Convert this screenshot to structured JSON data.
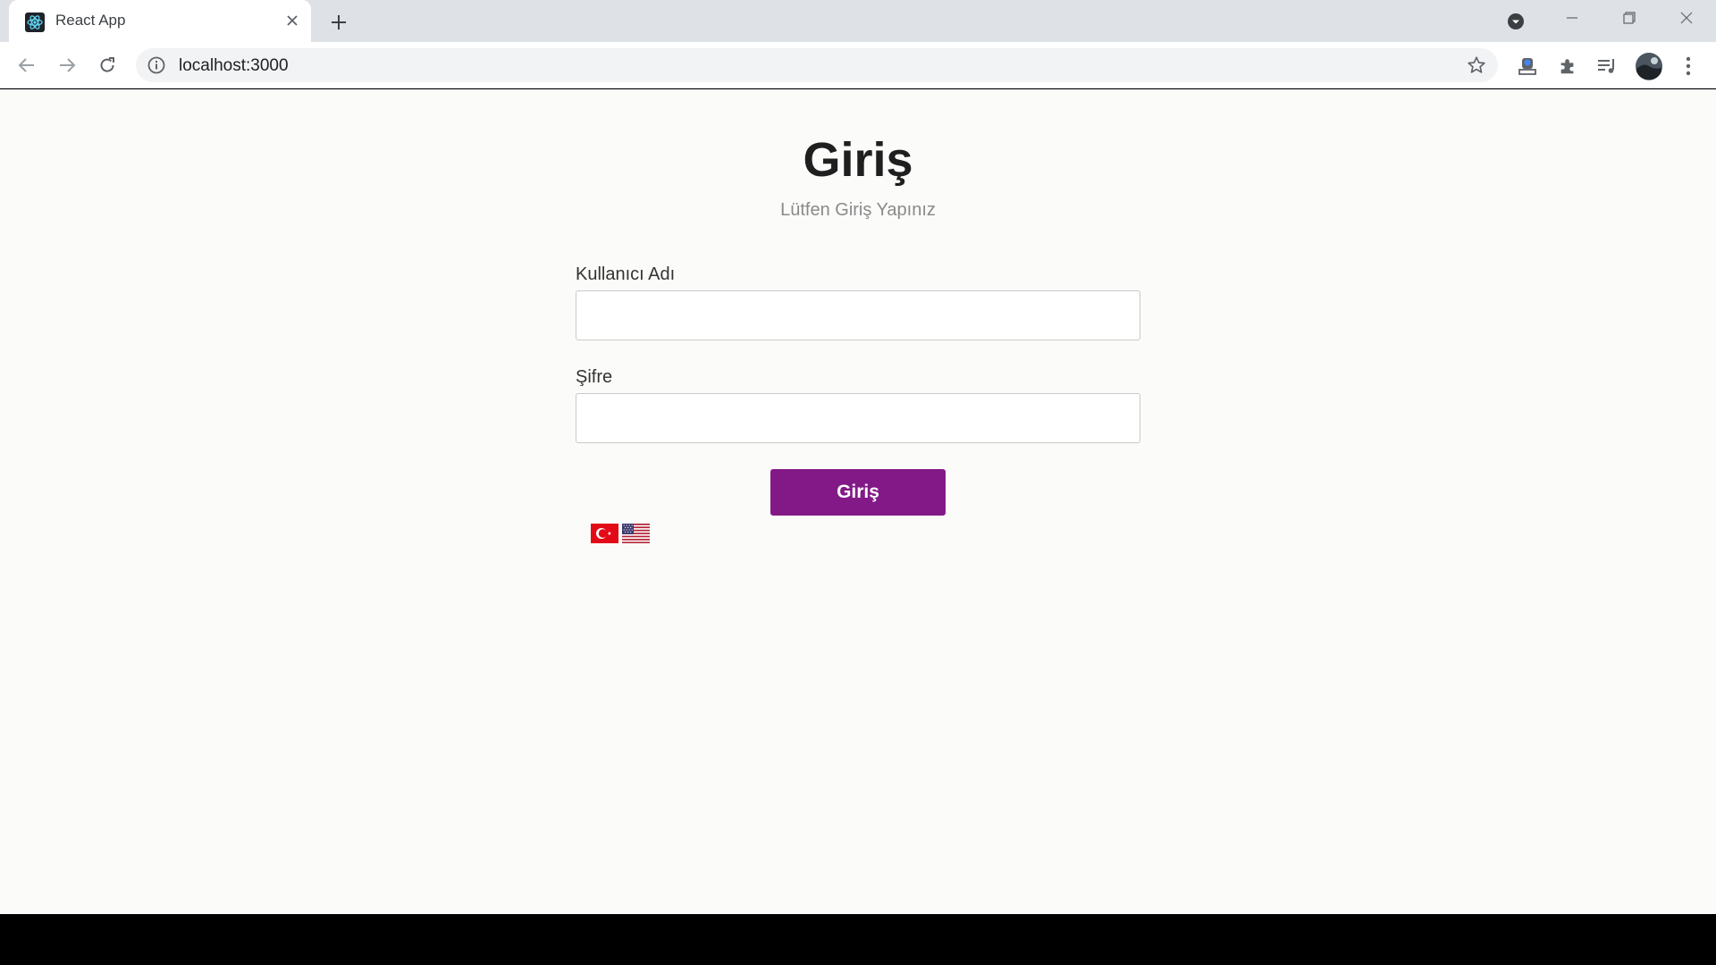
{
  "browser": {
    "tab_title": "React App",
    "url": "localhost:3000"
  },
  "login": {
    "title": "Giriş",
    "subtitle": "Lütfen Giriş Yapınız",
    "username_label": "Kullanıcı Adı",
    "username_value": "",
    "password_label": "Şifre",
    "password_value": "",
    "submit_label": "Giriş"
  },
  "languages": [
    "tr",
    "en"
  ],
  "colors": {
    "primary_button": "#831987",
    "page_background": "#fbfbfa",
    "title_text": "#1f1f1f",
    "subtitle_text": "#8a8a8a"
  }
}
